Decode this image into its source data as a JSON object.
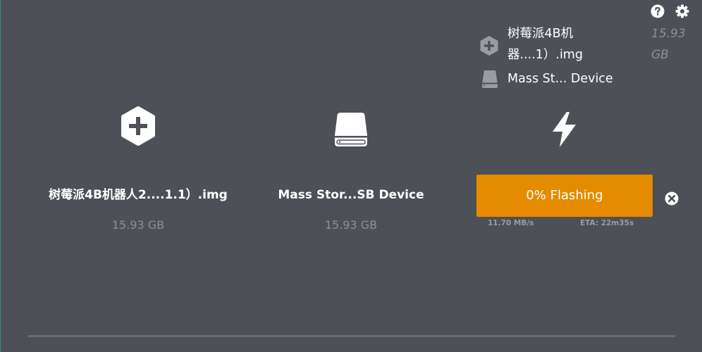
{
  "header": {
    "help_icon": "help-circle-icon",
    "settings_icon": "gear-icon"
  },
  "summary": {
    "image_name_line1": "树莓派4B机",
    "image_name_line2": "器....1）.img",
    "image_size_line1": "15.93",
    "image_size_line2": "GB",
    "image_icon": "add-image-icon",
    "drive_name": "Mass St... Device",
    "drive_icon": "drive-icon"
  },
  "steps": {
    "image": {
      "icon": "add-image-icon",
      "name": "树莓派4B机器人2....1.1）.img",
      "size": "15.93 GB"
    },
    "drive": {
      "icon": "drive-icon",
      "name": "Mass Stor...SB Device",
      "size": "15.93 GB"
    },
    "flash": {
      "icon": "lightning-bolt-icon",
      "progress_percent": 0,
      "button_label": "0% Flashing",
      "speed": "11.70 MB/s",
      "eta": "ETA: 22m35s",
      "cancel_icon": "cancel-icon"
    }
  },
  "colors": {
    "background": "#4d5057",
    "accent": "#e58b00",
    "muted_text": "#8c8f94"
  }
}
